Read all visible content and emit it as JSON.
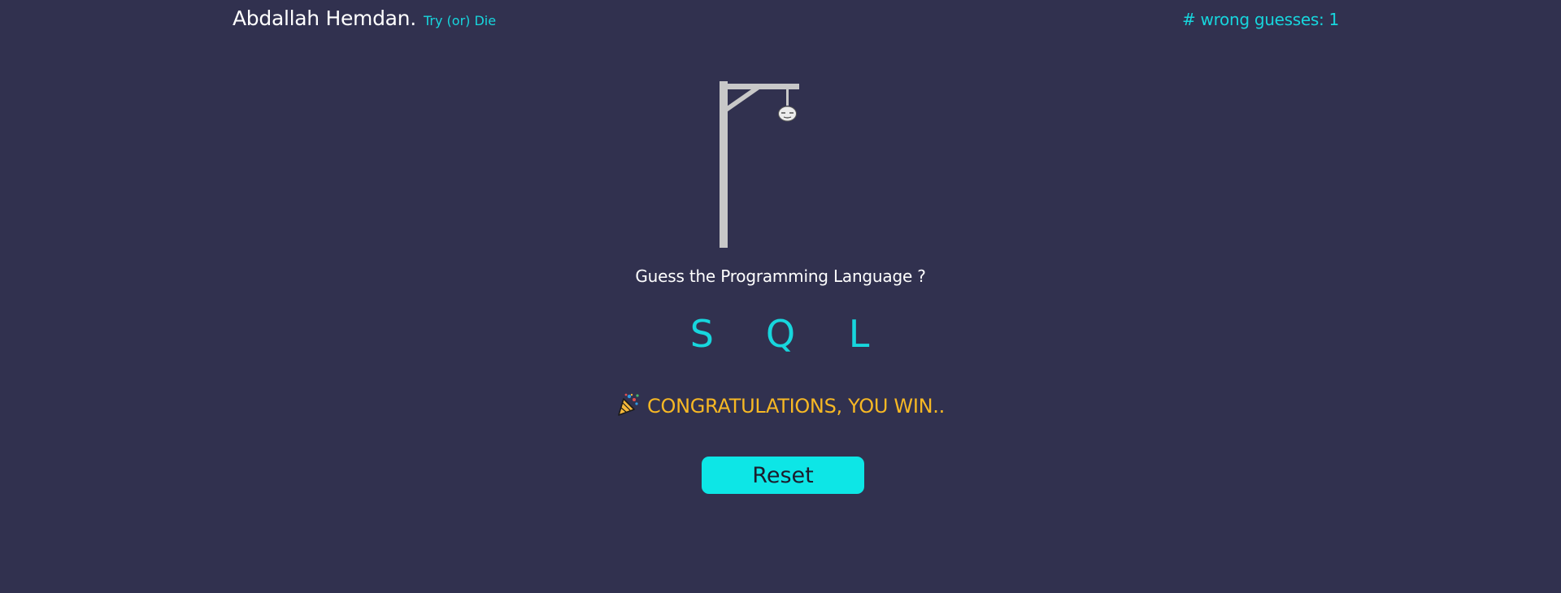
{
  "header": {
    "brand_name": "Abdallah Hemdan.",
    "brand_tagline": "Try (or) Die",
    "wrong_guesses_label": "# wrong guesses: 1"
  },
  "game": {
    "prompt": "Guess the Programming Language ?",
    "letters": [
      "S",
      "Q",
      "L"
    ],
    "wrong_guesses": 1,
    "result_message": "CONGRATULATIONS, YOU WIN..",
    "reset_label": "Reset"
  },
  "icons": {
    "gallows": "gallows-icon",
    "head": "hangman-head-icon",
    "celebration": "party-popper-icon"
  },
  "colors": {
    "background": "#31314f",
    "accent": "#17d6dd",
    "win": "#f7b824",
    "button": "#0de6e6"
  }
}
